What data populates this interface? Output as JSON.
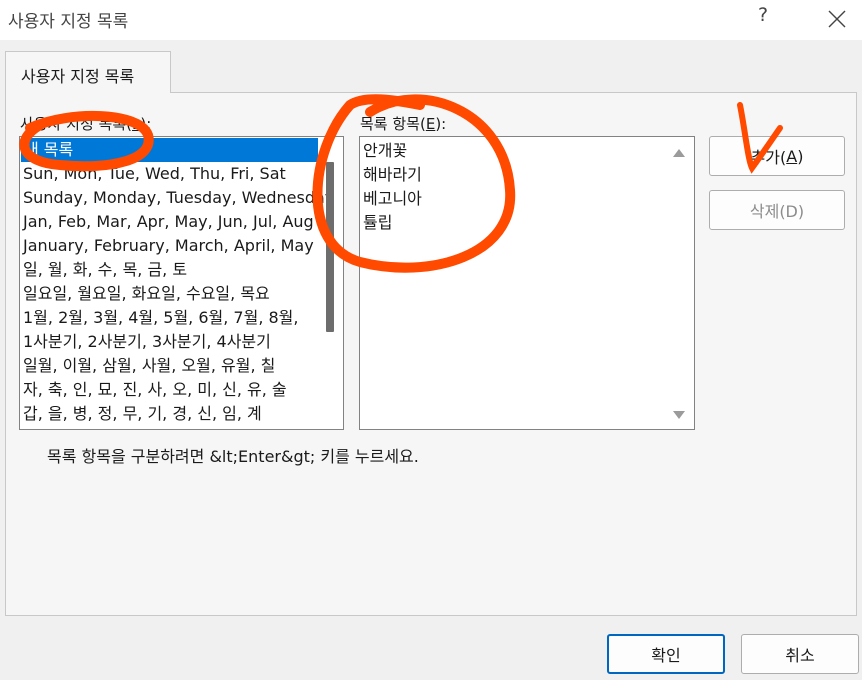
{
  "window": {
    "title": "사용자 지정 목록",
    "help_glyph": "?",
    "close_icon": "close-icon"
  },
  "tab": {
    "label": "사용자 지정 목록"
  },
  "lists_section": {
    "label_prefix": "사용자 지정 목록(",
    "label_key": "L",
    "label_suffix": "):",
    "items": [
      "새 목록",
      "Sun, Mon, Tue, Wed, Thu, Fri, Sat",
      "Sunday, Monday, Tuesday, Wednesday",
      "Jan, Feb, Mar, Apr, May, Jun, Jul, Aug",
      "January, February, March, April, May",
      "일, 월, 화, 수, 목, 금, 토",
      "일요일, 월요일, 화요일, 수요일, 목요",
      "1월, 2월, 3월, 4월, 5월, 6월, 7월, 8월,",
      "1사분기, 2사분기, 3사분기, 4사분기",
      "일월, 이월, 삼월, 사월, 오월, 유월, 칠",
      "자, 축, 인, 묘, 진, 사, 오, 미, 신, 유, 술",
      "갑, 을, 병, 정, 무, 기, 경, 신, 임, 계"
    ],
    "selected_index": 0
  },
  "entries_section": {
    "label_prefix": "목록 항목(",
    "label_key": "E",
    "label_suffix": "):",
    "entries": [
      "안개꽃",
      "해바라기",
      "베고니아",
      "튤립"
    ]
  },
  "buttons": {
    "add_prefix": "추가(",
    "add_key": "A",
    "add_suffix": ")",
    "delete_label": "삭제(D)",
    "ok_label": "확인",
    "cancel_label": "취소"
  },
  "hint": "목록 항목을 구분하려면 &lt;Enter&gt; 키를 누르세요.",
  "colors": {
    "selection": "#0078d7",
    "annotation": "#ff4a00"
  }
}
